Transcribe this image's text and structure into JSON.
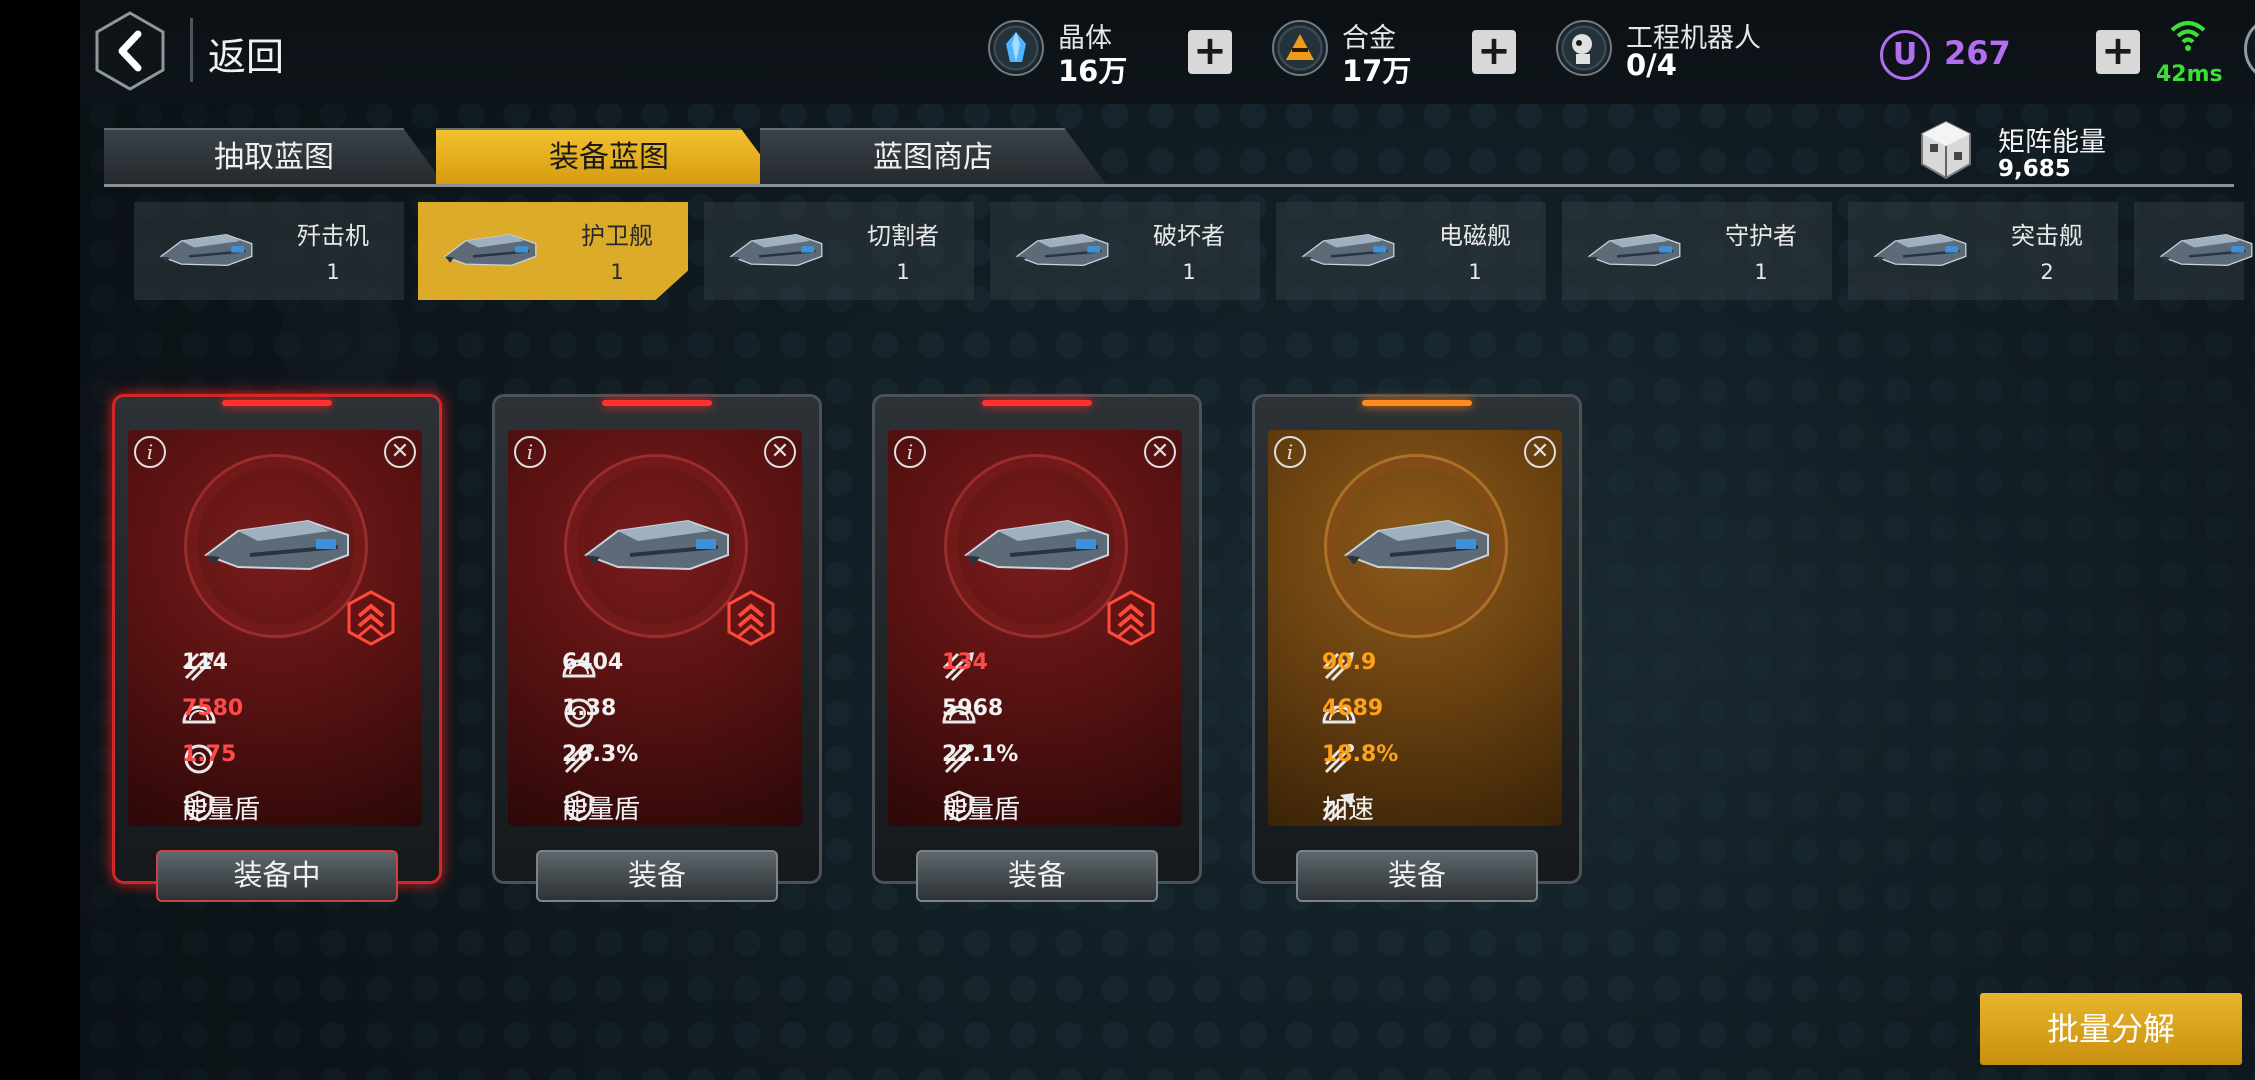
{
  "nav": {
    "back_label": "返回"
  },
  "resources": {
    "crystal": {
      "label": "晶体",
      "value": "16万"
    },
    "alloy": {
      "label": "合金",
      "value": "17万"
    },
    "robot": {
      "label": "工程机器人",
      "value": "0/4"
    },
    "u_currency": {
      "badge": "U",
      "value": "267"
    },
    "ping": "42ms",
    "plus_symbol": "+"
  },
  "tabs": [
    "抽取蓝图",
    "装备蓝图",
    "蓝图商店"
  ],
  "active_tab": 1,
  "matrix": {
    "label": "矩阵能量",
    "value": "9,685"
  },
  "categories": [
    {
      "name": "歼击机",
      "count": "1"
    },
    {
      "name": "护卫舰",
      "count": "1"
    },
    {
      "name": "切割者",
      "count": "1"
    },
    {
      "name": "破坏者",
      "count": "1"
    },
    {
      "name": "电磁舰",
      "count": "1"
    },
    {
      "name": "守护者",
      "count": "1"
    },
    {
      "name": "突击舰",
      "count": "2"
    }
  ],
  "active_category": 1,
  "cards": [
    {
      "stats": [
        "114",
        "7580",
        "1.75"
      ],
      "ability": "能量盾",
      "button": "装备中"
    },
    {
      "stats": [
        "6404",
        "1.38",
        "26.3%"
      ],
      "ability": "能量盾",
      "button": "装备"
    },
    {
      "stats": [
        "134",
        "5968",
        "22.1%"
      ],
      "ability": "能量盾",
      "button": "装备"
    },
    {
      "stats": [
        "90.9",
        "4689",
        "18.8%"
      ],
      "ability": "加速",
      "button": "装备"
    }
  ],
  "info_symbol": "i",
  "close_symbol": "✕",
  "batch_button": "批量分解",
  "colors": {
    "gold": "#dcab2a",
    "red_stat": "#ff4a4a",
    "orange_stat": "#ffa21a",
    "u_purple": "#b36ef0",
    "ping_green": "#3dde36"
  }
}
